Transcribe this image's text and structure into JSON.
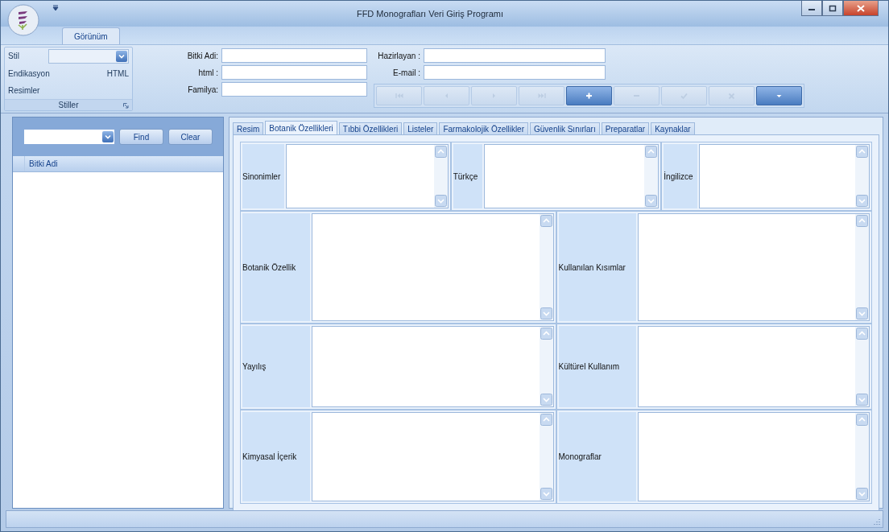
{
  "window": {
    "title": "FFD Monografları Veri Giriş Programı"
  },
  "ribbon": {
    "tabs": [
      {
        "label": "Görünüm",
        "selected": true
      }
    ],
    "group": {
      "caption": "Stiller",
      "combo_label": "Stil",
      "items": [
        {
          "label": "Endikasyon",
          "value": "HTML"
        },
        {
          "label": "Resimler"
        }
      ]
    }
  },
  "plant_fields": [
    {
      "label": "Bitki Adi:"
    },
    {
      "label": "html :"
    },
    {
      "label": "Familya:"
    }
  ],
  "author_fields": [
    {
      "label": "Hazirlayan :"
    },
    {
      "label": "E-mail :"
    }
  ],
  "navigator": [
    {
      "kind": "first",
      "enabled": false
    },
    {
      "kind": "prev",
      "enabled": false
    },
    {
      "kind": "next",
      "enabled": false
    },
    {
      "kind": "last",
      "enabled": false
    },
    {
      "kind": "add",
      "enabled": true
    },
    {
      "kind": "remove",
      "enabled": false
    },
    {
      "kind": "accept",
      "enabled": false
    },
    {
      "kind": "cancel",
      "enabled": false
    },
    {
      "kind": "more",
      "enabled": true
    }
  ],
  "search_panel": {
    "buttons": [
      "Find",
      "Clear"
    ],
    "grid_columns": [
      "Bitki Adi"
    ]
  },
  "tabs": [
    {
      "label": "Resim",
      "selected": false
    },
    {
      "label": "Botanik Özellikleri",
      "selected": true
    },
    {
      "label": "Tıbbi Özellikleri",
      "selected": false
    },
    {
      "label": "Listeler",
      "selected": false
    },
    {
      "label": "Farmakolojik Özellikler",
      "selected": false
    },
    {
      "label": "Güvenlik Sınırları",
      "selected": false
    },
    {
      "label": "Preparatlar",
      "selected": false
    },
    {
      "label": "Kaynaklar",
      "selected": false
    }
  ],
  "memo_rows": [
    [
      {
        "label": "Sinonimler"
      },
      {
        "label": "Türkçe"
      },
      {
        "label": "İngilizce"
      }
    ],
    [
      {
        "label": "Botanik Özellik"
      },
      {
        "label": "Kullanılan Kısımlar"
      }
    ],
    [
      {
        "label": "Yayılış"
      },
      {
        "label": "Kültürel Kullanım"
      }
    ],
    [
      {
        "label": "Kimyasal İçerik"
      },
      {
        "label": "Monograflar"
      }
    ]
  ]
}
